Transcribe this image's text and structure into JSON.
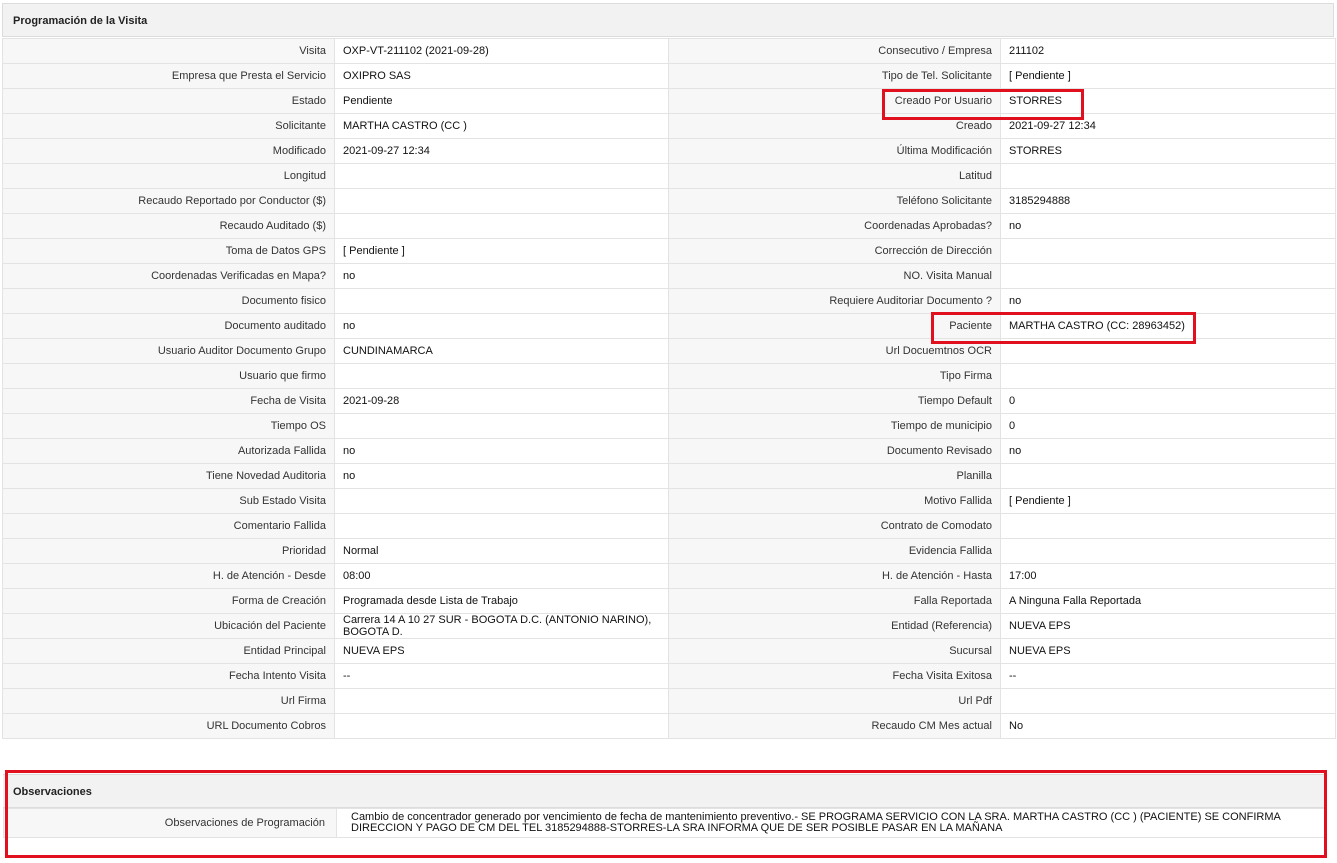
{
  "section_title": "Programación de la Visita",
  "rows": [
    {
      "l1": "Visita",
      "v1": "OXP-VT-211102 (2021-09-28)",
      "l2": "Consecutivo / Empresa",
      "v2": "211102"
    },
    {
      "l1": "Empresa que Presta el Servicio",
      "v1": "OXIPRO SAS",
      "l2": "Tipo de Tel. Solicitante",
      "v2": "[ Pendiente ]"
    },
    {
      "l1": "Estado",
      "v1": "Pendiente",
      "l2": "Creado Por Usuario",
      "v2": "STORRES"
    },
    {
      "l1": "Solicitante",
      "v1": "MARTHA CASTRO (CC )",
      "l2": "Creado",
      "v2": "2021-09-27 12:34"
    },
    {
      "l1": "Modificado",
      "v1": "2021-09-27 12:34",
      "l2": "Última Modificación",
      "v2": " STORRES"
    },
    {
      "l1": "Longitud",
      "v1": "",
      "l2": "Latitud",
      "v2": ""
    },
    {
      "l1": "Recaudo Reportado por Conductor ($)",
      "v1": "",
      "l2": "Teléfono Solicitante",
      "v2": "3185294888"
    },
    {
      "l1": "Recaudo Auditado ($)",
      "v1": "",
      "l2": "Coordenadas Aprobadas?",
      "v2": " no"
    },
    {
      "l1": "Toma de Datos GPS",
      "v1": "[ Pendiente ]",
      "l2": "Corrección de Dirección",
      "v2": ""
    },
    {
      "l1": "Coordenadas Verificadas en Mapa?",
      "v1": " no",
      "l2": "NO. Visita Manual",
      "v2": ""
    },
    {
      "l1": "Documento fisico",
      "v1": "",
      "l2": "Requiere Auditoriar Documento ?",
      "v2": " no"
    },
    {
      "l1": "Documento auditado",
      "v1": " no",
      "l2": "Paciente",
      "v2": "MARTHA CASTRO (CC: 28963452)"
    },
    {
      "l1": "Usuario Auditor Documento Grupo",
      "v1": "CUNDINAMARCA",
      "l2": "Url Docuemtnos OCR",
      "v2": ""
    },
    {
      "l1": "Usuario que firmo",
      "v1": "",
      "l2": "Tipo Firma",
      "v2": ""
    },
    {
      "l1": "Fecha de Visita",
      "v1": " 2021-09-28",
      "l2": "Tiempo Default",
      "v2": "0"
    },
    {
      "l1": "Tiempo OS",
      "v1": "",
      "l2": "Tiempo de municipio",
      "v2": "0"
    },
    {
      "l1": "Autorizada Fallida",
      "v1": " no",
      "l2": "Documento Revisado",
      "v2": " no"
    },
    {
      "l1": "Tiene Novedad Auditoria",
      "v1": " no",
      "l2": "Planilla",
      "v2": ""
    },
    {
      "l1": "Sub Estado Visita",
      "v1": "",
      "l2": "Motivo Fallida",
      "v2": "[ Pendiente ]"
    },
    {
      "l1": "Comentario Fallida",
      "v1": "",
      "l2": "Contrato de Comodato",
      "v2": ""
    },
    {
      "l1": "Prioridad",
      "v1": "Normal",
      "l2": "Evidencia Fallida",
      "v2": ""
    },
    {
      "l1": "H. de Atención - Desde",
      "v1": "08:00",
      "l2": "H. de Atención - Hasta",
      "v2": "17:00"
    },
    {
      "l1": "Forma de Creación",
      "v1": "Programada desde Lista de Trabajo",
      "l2": "Falla Reportada",
      "v2": "A Ninguna Falla Reportada"
    },
    {
      "l1": "Ubicación del Paciente",
      "v1": "Carrera 14 A 10 27 SUR - BOGOTA D.C. (ANTONIO NARINO), BOGOTA D.",
      "l2": "Entidad (Referencia)",
      "v2": "NUEVA EPS"
    },
    {
      "l1": "Entidad Principal",
      "v1": "NUEVA EPS",
      "l2": "Sucursal",
      "v2": "NUEVA EPS"
    },
    {
      "l1": "Fecha Intento Visita",
      "v1": " --",
      "l2": "Fecha Visita Exitosa",
      "v2": " --"
    },
    {
      "l1": "Url Firma",
      "v1": "",
      "l2": "Url Pdf",
      "v2": ""
    },
    {
      "l1": "URL Documento Cobros",
      "v1": "",
      "l2": "Recaudo CM Mes actual",
      "v2": "No"
    }
  ],
  "observaciones": {
    "title": "Observaciones",
    "label": "Observaciones de Programación",
    "text": "Cambio de concentrador generado por vencimiento de fecha de mantenimiento preventivo.- SE PROGRAMA SERVICIO CON LA SRA. MARTHA CASTRO (CC ) (PACIENTE) SE CONFIRMA DIRECCION Y PAGO DE CM DEL TEL 3185294888-STORRES-LA SRA INFORMA QUE DE SER POSIBLE PASAR EN LA MAÑANA"
  },
  "colors": {
    "highlight": "#e0101e",
    "header_bg": "#f2f2f2",
    "label_bg": "#f7f7f7"
  }
}
